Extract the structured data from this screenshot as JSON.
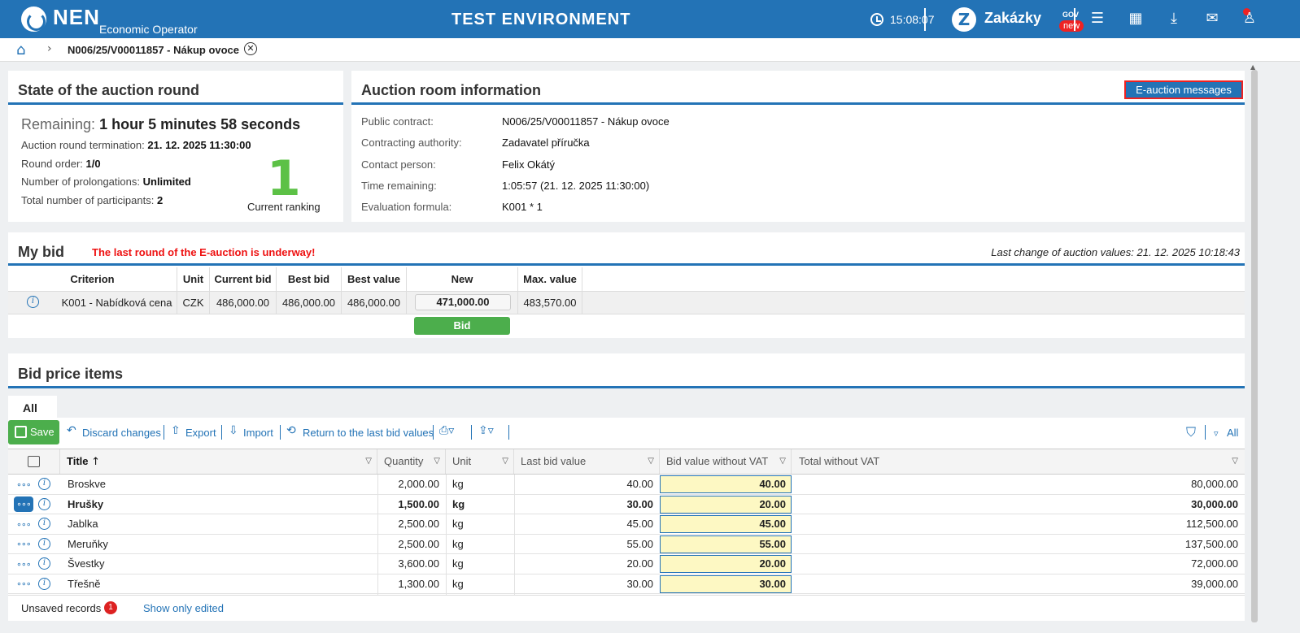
{
  "header": {
    "logo": "NEN",
    "logo_sub": "Economic Operator",
    "env": "TEST ENVIRONMENT",
    "time": "15:08:07",
    "zakazky": "Zakázky",
    "gov": "GOV",
    "new_badge": "new",
    "icons": [
      "clock-icon",
      "menu-icon",
      "calendar-icon",
      "download-icon",
      "mail-icon",
      "user-icon"
    ]
  },
  "breadcrumb": {
    "current": "N006/25/V00011857 - Nákup ovoce"
  },
  "state": {
    "title": "State of the auction round",
    "remaining_label": "Remaining:",
    "remaining_value": "1 hour 5 minutes 58 seconds",
    "termination_label": "Auction round termination:",
    "termination_value": "21. 12. 2025 11:30:00",
    "round_label": "Round order:",
    "round_value": "1/0",
    "prolong_label": "Number of prolongations:",
    "prolong_value": "Unlimited",
    "participants_label": "Total number of participants:",
    "participants_value": "2",
    "ranking": "1",
    "ranking_label": "Current ranking"
  },
  "room": {
    "title": "Auction room information",
    "messages_button": "E-auction messages",
    "rows": [
      {
        "label": "Public contract:",
        "value": "N006/25/V00011857 - Nákup ovoce"
      },
      {
        "label": "Contracting authority:",
        "value": "Zadavatel příručka"
      },
      {
        "label": "Contact person:",
        "value": "Felix Okátý"
      },
      {
        "label": "Time remaining:",
        "value": "1:05:57 (21. 12. 2025 11:30:00)"
      },
      {
        "label": "Evaluation formula:",
        "value": "K001 * 1"
      }
    ]
  },
  "mybid": {
    "title": "My bid",
    "warning": "The last round of the E-auction is underway!",
    "last_change": "Last change of auction values: 21. 12. 2025 10:18:43",
    "headers": [
      "Criterion",
      "Unit",
      "Current bid",
      "Best bid",
      "Best value",
      "New",
      "Max. value"
    ],
    "row": {
      "criterion": "K001 - Nabídková cena",
      "unit": "CZK",
      "current": "486,000.00",
      "best_bid": "486,000.00",
      "best_value": "486,000.00",
      "new": "471,000.00",
      "max": "483,570.00"
    },
    "bid_button": "Bid"
  },
  "items": {
    "title": "Bid price items",
    "tab": "All",
    "toolbar": {
      "save": "Save",
      "discard": "Discard changes",
      "export": "Export",
      "import": "Import",
      "return": "Return to the last bid values",
      "filter_all": "All"
    },
    "headers": {
      "title": "Title",
      "quantity": "Quantity",
      "unit": "Unit",
      "last_bid": "Last bid value",
      "bid_value": "Bid value without VAT",
      "total": "Total without VAT"
    },
    "rows": [
      {
        "title": "Broskve",
        "quantity": "2,000.00",
        "unit": "kg",
        "last": "40.00",
        "bid": "40.00",
        "total": "80,000.00",
        "edited": false
      },
      {
        "title": "Hrušky",
        "quantity": "1,500.00",
        "unit": "kg",
        "last": "30.00",
        "bid": "20.00",
        "total": "30,000.00",
        "edited": true
      },
      {
        "title": "Jablka",
        "quantity": "2,500.00",
        "unit": "kg",
        "last": "45.00",
        "bid": "45.00",
        "total": "112,500.00",
        "edited": false
      },
      {
        "title": "Meruňky",
        "quantity": "2,500.00",
        "unit": "kg",
        "last": "55.00",
        "bid": "55.00",
        "total": "137,500.00",
        "edited": false
      },
      {
        "title": "Švestky",
        "quantity": "3,600.00",
        "unit": "kg",
        "last": "20.00",
        "bid": "20.00",
        "total": "72,000.00",
        "edited": false
      },
      {
        "title": "Třešně",
        "quantity": "1,300.00",
        "unit": "kg",
        "last": "30.00",
        "bid": "30.00",
        "total": "39,000.00",
        "edited": false
      }
    ],
    "footer": {
      "unsaved": "Unsaved records",
      "count": "1",
      "show_edited": "Show only edited"
    }
  }
}
